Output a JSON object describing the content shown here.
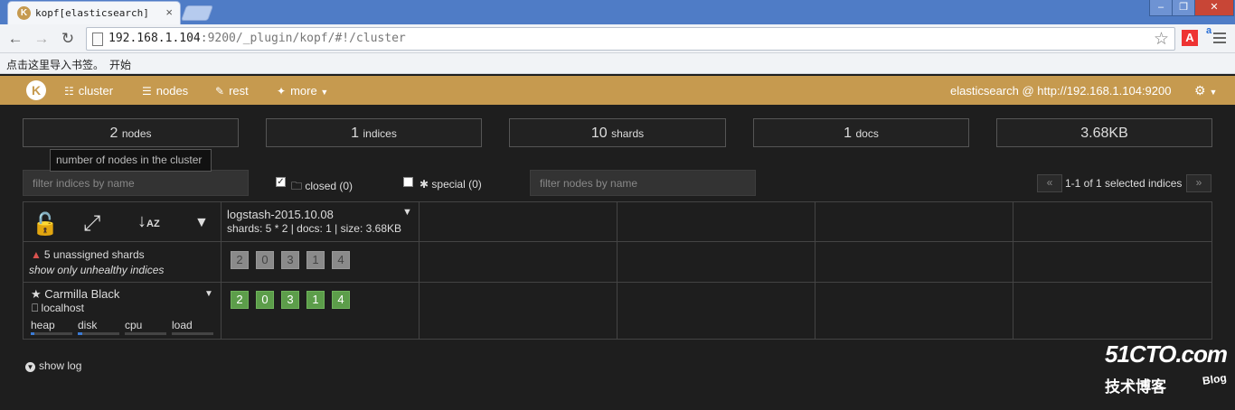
{
  "browser": {
    "tab_title": "kopf[elasticsearch]",
    "url_host": "192.168.1.104",
    "url_rest": ":9200/_plugin/kopf/#!/cluster",
    "bookmarks": [
      "点击这里导入书签。",
      "开始"
    ],
    "tab_close": "×"
  },
  "nav": {
    "logo": "K",
    "items": [
      "cluster",
      "nodes",
      "rest",
      "more"
    ],
    "cluster_url": "elasticsearch @ http://192.168.1.104:9200"
  },
  "stats": [
    {
      "num": "2",
      "label": "nodes"
    },
    {
      "num": "1",
      "label": "indices"
    },
    {
      "num": "10",
      "label": "shards"
    },
    {
      "num": "1",
      "label": "docs"
    },
    {
      "num": "3.68KB",
      "label": ""
    }
  ],
  "tooltip": "number of nodes in the cluster",
  "filters": {
    "indices_placeholder": "filter indices by name",
    "closed_label": "closed (0)",
    "special_label": "special (0)",
    "nodes_placeholder": "filter nodes by name",
    "pager_text": "1-1 of 1 selected indices",
    "prev": "«",
    "next": "»"
  },
  "index": {
    "name": "logstash-2015.10.08",
    "info": "shards: 5 * 2 | docs: 1 | size: 3.68KB"
  },
  "unassigned": {
    "warning": "5 unassigned shards",
    "link": "show only unhealthy indices",
    "shards": [
      "2",
      "0",
      "3",
      "1",
      "4"
    ]
  },
  "node": {
    "name": "Carmilla Black",
    "host": "localhost",
    "shards": [
      "2",
      "0",
      "3",
      "1",
      "4"
    ],
    "metrics": [
      {
        "label": "heap",
        "fill": 0.08
      },
      {
        "label": "disk",
        "fill": 0.1
      },
      {
        "label": "cpu",
        "fill": 0
      },
      {
        "label": "load",
        "fill": 0
      }
    ]
  },
  "show_log": "show log",
  "watermark": {
    "big": "51CTO.com",
    "small": "技术博客",
    "blog": "Blog"
  }
}
